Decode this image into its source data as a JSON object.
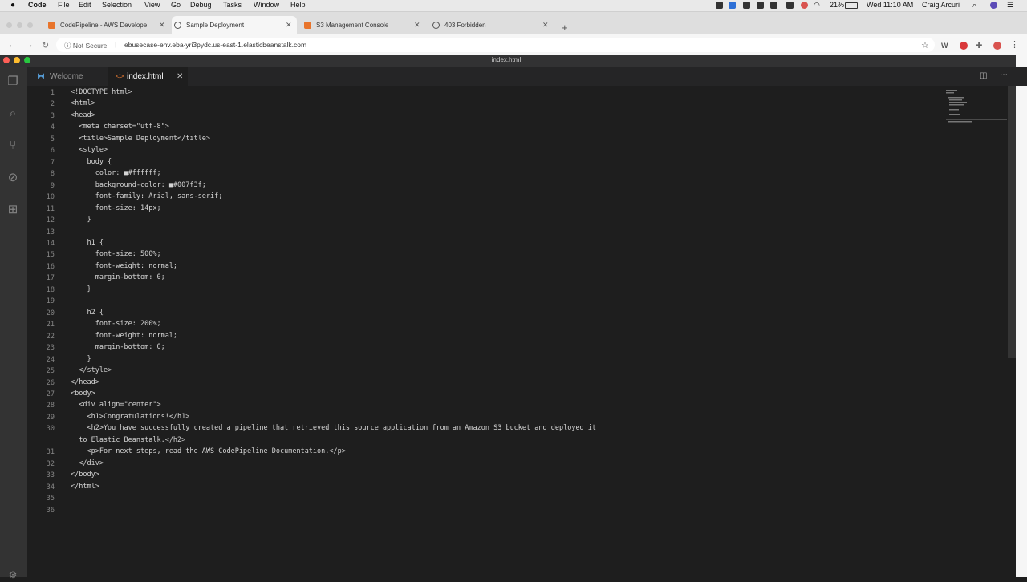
{
  "menubar": {
    "app": "Code",
    "items": [
      "File",
      "Edit",
      "Selection",
      "View",
      "Go",
      "Debug",
      "Tasks",
      "Window",
      "Help"
    ],
    "battery": "21%",
    "clock": "Wed 11:10 AM",
    "user": "Craig Arcuri"
  },
  "browser": {
    "tabs": [
      {
        "label": "CodePipeline - AWS Develope",
        "favicon_color": "#e8742b"
      },
      {
        "label": "Sample Deployment",
        "favicon_color": "#555555"
      },
      {
        "label": "S3 Management Console",
        "favicon_color": "#e8742b"
      },
      {
        "label": "403 Forbidden",
        "favicon_color": "#555555"
      }
    ],
    "security": "Not Secure",
    "url": "ebusecase-env.eba-yri3pydc.us-east-1.elasticbeanstalk.com"
  },
  "vscode": {
    "window_title": "index.html",
    "tabs": [
      "Welcome",
      "index.html"
    ],
    "lines": [
      "<!DOCTYPE html>",
      "<html>",
      "<head>",
      "  <meta charset=\"utf-8\">",
      "  <title>Sample Deployment</title>",
      "  <style>",
      "    body {",
      "      color: ■#ffffff;",
      "      background-color: ■#007f3f;",
      "      font-family: Arial, sans-serif;",
      "      font-size: 14px;",
      "    }",
      "",
      "    h1 {",
      "      font-size: 500%;",
      "      font-weight: normal;",
      "      margin-bottom: 0;",
      "    }",
      "",
      "    h2 {",
      "      font-size: 200%;",
      "      font-weight: normal;",
      "      margin-bottom: 0;",
      "    }",
      "  </style>",
      "</head>",
      "<body>",
      "  <div align=\"center\">",
      "    <h1>Congratulations!</h1>",
      "    <h2>You have successfully created a pipeline that retrieved this source application from an Amazon S3 bucket and deployed it\n  to Elastic Beanstalk.</h2>",
      "    <p>For next steps, read the AWS CodePipeline Documentation.</p>",
      "  </div>",
      "</body>",
      "</html>",
      "",
      ""
    ]
  }
}
